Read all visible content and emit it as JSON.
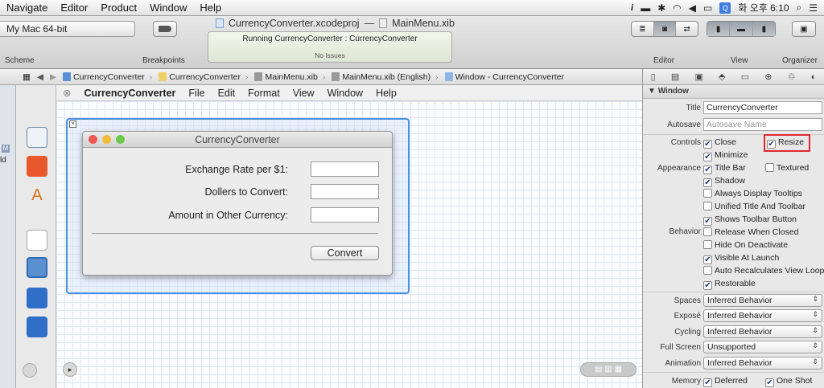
{
  "menubar": {
    "items": [
      "Navigate",
      "Editor",
      "Product",
      "Window",
      "Help"
    ],
    "clock": "화 오후 6:10"
  },
  "toolbar": {
    "window_title": "CurrencyConverter.xcodeproj",
    "window_title_sep": "—",
    "window_title_file": "MainMenu.xib",
    "scheme_value": "My Mac 64-bit",
    "scheme_label": "Scheme",
    "breakpoints_label": "Breakpoints",
    "status_text": "Running CurrencyConverter : CurrencyConverter",
    "status_sub": "No Issues",
    "editor_label": "Editor",
    "view_label": "View",
    "organizer_label": "Organizer"
  },
  "jumpbar": {
    "crumbs": [
      "CurrencyConverter",
      "CurrencyConverter",
      "MainMenu.xib",
      "MainMenu.xib (English)",
      "Window - CurrencyConverter"
    ]
  },
  "leftnav": {
    "badge": "M",
    "fragment": "ld"
  },
  "ib_menu": {
    "items": [
      "CurrencyConverter",
      "File",
      "Edit",
      "Format",
      "View",
      "Window",
      "Help"
    ]
  },
  "app_window": {
    "title": "CurrencyConverter",
    "rows": [
      {
        "label": "Exchange Rate per $1:"
      },
      {
        "label": "Dollers to Convert:"
      },
      {
        "label": "Amount in Other Currency:"
      }
    ],
    "convert_label": "Convert"
  },
  "inspector": {
    "section": "Window",
    "title_label": "Title",
    "title_value": "CurrencyConverter",
    "autosave_label": "Autosave",
    "autosave_placeholder": "Autosave Name",
    "controls_label": "Controls",
    "controls": [
      {
        "label": "Close",
        "checked": true
      },
      {
        "label": "Resize",
        "checked": true
      },
      {
        "label": "Minimize",
        "checked": true
      }
    ],
    "appearance_label": "Appearance",
    "appearance": [
      {
        "label": "Title Bar",
        "checked": true
      },
      {
        "label": "Textured",
        "checked": false
      },
      {
        "label": "Shadow",
        "checked": true
      },
      {
        "label": "Always Display Tooltips",
        "checked": false
      },
      {
        "label": "Unified Title And Toolbar",
        "checked": false
      },
      {
        "label": "Shows Toolbar Button",
        "checked": true
      }
    ],
    "behavior_label": "Behavior",
    "behavior": [
      {
        "label": "Release When Closed",
        "checked": false
      },
      {
        "label": "Hide On Deactivate",
        "checked": false
      },
      {
        "label": "Visible At Launch",
        "checked": true
      },
      {
        "label": "Auto Recalculates View Loop",
        "checked": false
      },
      {
        "label": "Restorable",
        "checked": true
      }
    ],
    "popups": [
      {
        "label": "Spaces",
        "value": "Inferred Behavior"
      },
      {
        "label": "Exposé",
        "value": "Inferred Behavior"
      },
      {
        "label": "Cycling",
        "value": "Inferred Behavior"
      },
      {
        "label": "Full Screen",
        "value": "Unsupported"
      },
      {
        "label": "Animation",
        "value": "Inferred Behavior"
      }
    ],
    "memory_label": "Memory",
    "memory": [
      {
        "label": "Deferred",
        "checked": true
      },
      {
        "label": "One Shot",
        "checked": true
      }
    ],
    "highlight_color": "#e0282e"
  }
}
